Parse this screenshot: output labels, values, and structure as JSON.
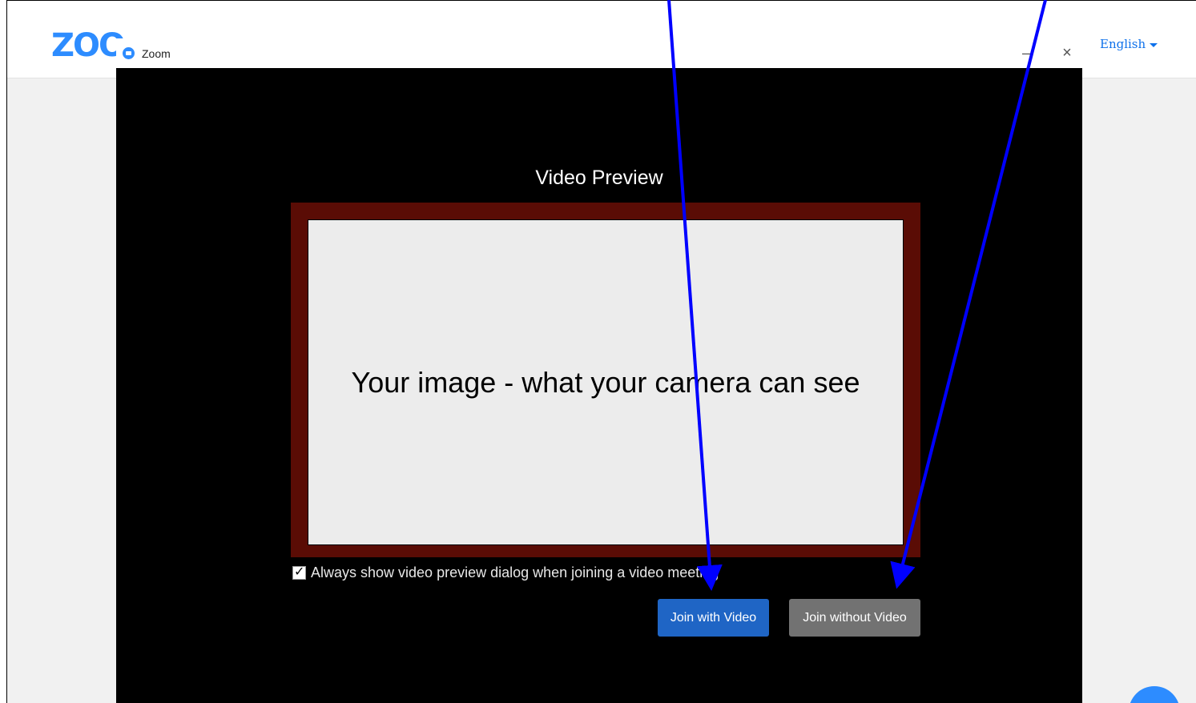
{
  "browser": {
    "logo_text": "ZOO",
    "language": "English"
  },
  "zoom_window": {
    "title": "Zoom",
    "minimize_glyph": "–",
    "close_glyph": "×"
  },
  "video_preview": {
    "heading": "Video Preview",
    "placeholder_text": "Your image - what your camera can see",
    "checkbox_label": "Always show video preview dialog when joining a video meeting",
    "checkbox_checked": true
  },
  "buttons": {
    "join_with_video": "Join with Video",
    "join_without_video": "Join without Video"
  },
  "colors": {
    "zoom_blue": "#2d8cff",
    "join_video_button": "#1f65c5",
    "join_without_video_button": "#727272",
    "preview_border": "#5a0c05",
    "annotation_arrow": "#0000ff"
  },
  "icons": {
    "app": "zoom-app-icon",
    "language_caret": "chevron-down-icon",
    "checkmark": "checkmark-icon"
  }
}
